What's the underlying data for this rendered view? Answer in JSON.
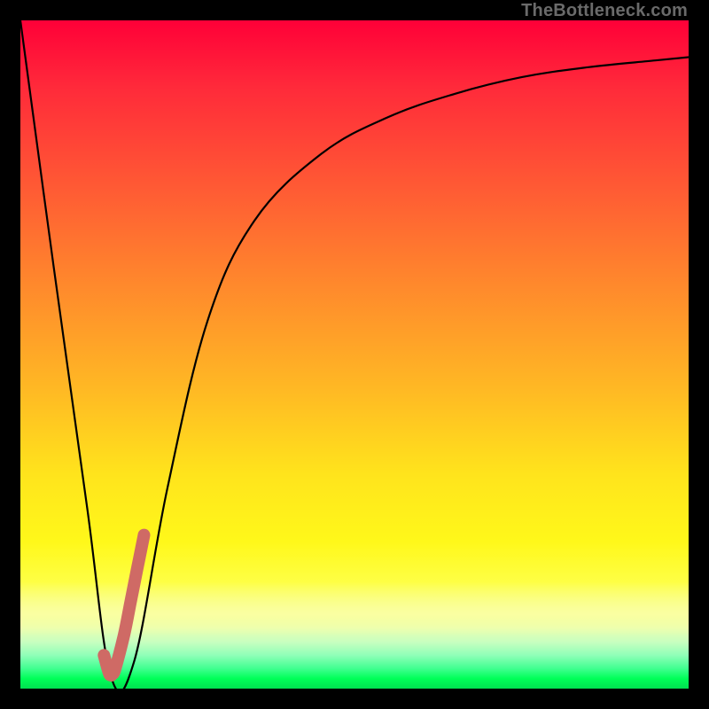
{
  "watermark": "TheBottleneck.com",
  "colors": {
    "background": "#000000",
    "curve": "#000000",
    "highlight": "#cf6a65",
    "gradient_top": "#ff0038",
    "gradient_bottom": "#00e050"
  },
  "chart_data": {
    "type": "line",
    "title": "",
    "xlabel": "",
    "ylabel": "",
    "xlim": [
      0,
      100
    ],
    "ylim": [
      0,
      100
    ],
    "grid": false,
    "legend": false,
    "series": [
      {
        "name": "bottleneck-curve",
        "x": [
          0,
          5,
          10,
          13.5,
          17,
          22,
          28,
          35,
          45,
          55,
          65,
          75,
          85,
          95,
          100
        ],
        "y": [
          100,
          63,
          27,
          2,
          4,
          30,
          55,
          70,
          80,
          85.5,
          89,
          91.5,
          93,
          94,
          94.5
        ]
      },
      {
        "name": "highlight-segment",
        "x": [
          12.5,
          13.2,
          13.5,
          13.8,
          14.2,
          15.5,
          16.5,
          17.5,
          18.5
        ],
        "y": [
          5,
          2.5,
          2,
          2.2,
          3,
          8,
          13,
          18,
          23
        ]
      }
    ],
    "annotations": []
  }
}
